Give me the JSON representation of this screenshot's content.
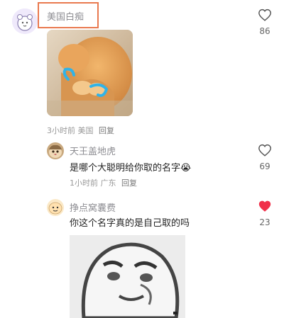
{
  "comments": [
    {
      "username": "美国白痴",
      "likes": "86",
      "time": "3小时前",
      "location": "美国",
      "reply_label": "回复",
      "liked": false
    },
    {
      "username": "天王盖地虎",
      "text": "是哪个大聪明给你取的名字",
      "emoji": "😭",
      "likes": "69",
      "time": "1小时前",
      "location": "广东",
      "reply_label": "回复",
      "liked": false
    },
    {
      "username": "挣点窝囊费",
      "text": "你这个名字真的是自己取的吗",
      "likes": "23",
      "liked": true
    }
  ],
  "colors": {
    "highlight_box": "#e9794f",
    "liked_heart": "#f0304a",
    "username": "#8e8e93"
  }
}
